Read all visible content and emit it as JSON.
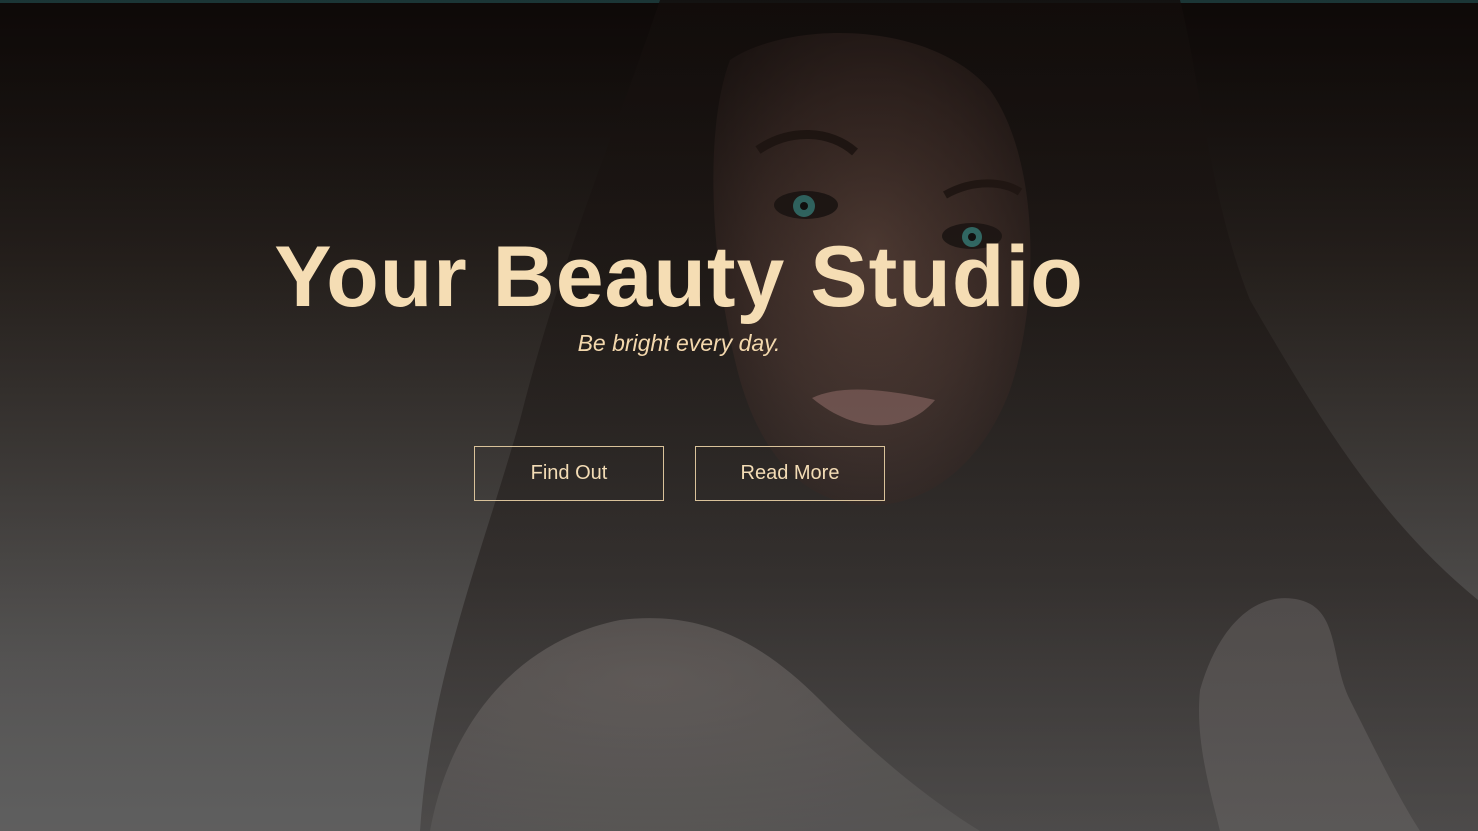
{
  "hero": {
    "title": "Your Beauty Studio",
    "subtitle": "Be bright every day."
  },
  "buttons": {
    "find_out": "Find Out",
    "read_more": "Read More"
  },
  "colors": {
    "accent_text": "#f5ddb4",
    "button_border": "#d9c29a",
    "top_bar": "#2f6f72"
  }
}
